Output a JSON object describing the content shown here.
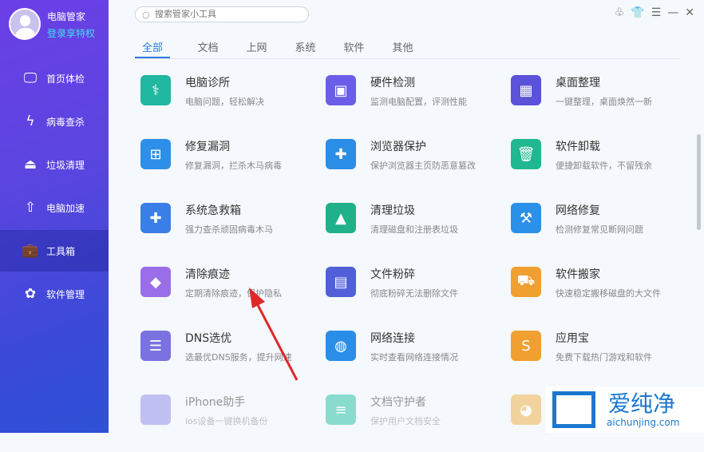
{
  "user": {
    "name": "电脑管家",
    "login": "登录享特权"
  },
  "nav": [
    {
      "label": "首页体检",
      "icon": "monitor-icon"
    },
    {
      "label": "病毒查杀",
      "icon": "lightning-icon"
    },
    {
      "label": "垃圾清理",
      "icon": "broom-icon"
    },
    {
      "label": "电脑加速",
      "icon": "rocket-icon"
    },
    {
      "label": "工具箱",
      "icon": "toolbox-icon"
    },
    {
      "label": "软件管理",
      "icon": "software-icon"
    }
  ],
  "search": {
    "placeholder": "搜索管家小工具"
  },
  "tabs": [
    "全部",
    "文档",
    "上网",
    "系统",
    "软件",
    "其他"
  ],
  "tools": [
    {
      "name": "电脑诊所",
      "desc": "电脑问题，轻松解决",
      "color": "#20b8a0",
      "glyph": "⚕"
    },
    {
      "name": "硬件检测",
      "desc": "监测电脑配置，评测性能",
      "color": "#6a5ee8",
      "glyph": "▣"
    },
    {
      "name": "桌面整理",
      "desc": "一键整理，桌面焕然一新",
      "color": "#5a52d8",
      "glyph": "▦"
    },
    {
      "name": "修复漏洞",
      "desc": "修复漏洞，拦杀木马病毒",
      "color": "#2e8fe8",
      "glyph": "⊞"
    },
    {
      "name": "浏览器保护",
      "desc": "保护浏览器主页防恶意篡改",
      "color": "#2a8de6",
      "glyph": "✚"
    },
    {
      "name": "软件卸载",
      "desc": "便捷卸载软件，不留残余",
      "color": "#1fb890",
      "glyph": "🗑"
    },
    {
      "name": "系统急救箱",
      "desc": "强力查杀顽固病毒木马",
      "color": "#3a7ee8",
      "glyph": "✚"
    },
    {
      "name": "清理垃圾",
      "desc": "清理磁盘和注册表垃圾",
      "color": "#20b08a",
      "glyph": "▲"
    },
    {
      "name": "网络修复",
      "desc": "检测修复常见断网问题",
      "color": "#2a90e8",
      "glyph": "⚒"
    },
    {
      "name": "清除痕迹",
      "desc": "定期清除痕迹，保护隐私",
      "color": "#9a6ee8",
      "glyph": "◆"
    },
    {
      "name": "文件粉碎",
      "desc": "彻底粉碎无法删除文件",
      "color": "#5060d8",
      "glyph": "▤"
    },
    {
      "name": "软件搬家",
      "desc": "快速稳定搬移磁盘的大文件",
      "color": "#f0a030",
      "glyph": "⛟"
    },
    {
      "name": "DNS选优",
      "desc": "选最优DNS服务，提升网速",
      "color": "#7a72e0",
      "glyph": "☰"
    },
    {
      "name": "网络连接",
      "desc": "实时查看网络连接情况",
      "color": "#2a8ee8",
      "glyph": "◍"
    },
    {
      "name": "应用宝",
      "desc": "免费下载热门游戏和软件",
      "color": "#f0a030",
      "glyph": "S"
    },
    {
      "name": "iPhone助手",
      "desc": "ios设备一键换机备份",
      "color": "#8a88e8",
      "glyph": ""
    },
    {
      "name": "文档守护者",
      "desc": "保护用户文档安全",
      "color": "#20c0a0",
      "glyph": "≡"
    },
    {
      "name": "",
      "desc": "",
      "color": "#f0b040",
      "glyph": "◕"
    }
  ],
  "watermark": {
    "brand": "爱纯净",
    "url": "aichunjing.com"
  }
}
